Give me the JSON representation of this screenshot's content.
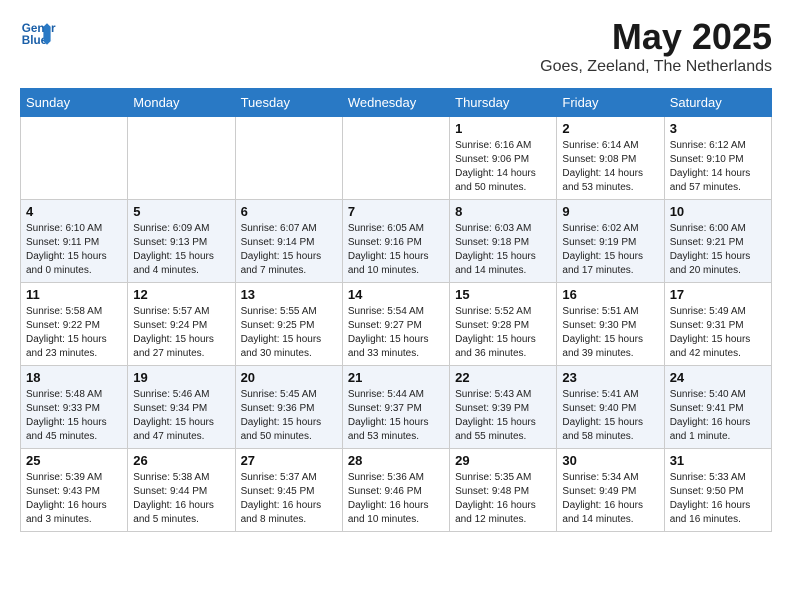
{
  "logo": {
    "line1": "General",
    "line2": "Blue"
  },
  "title": "May 2025",
  "location": "Goes, Zeeland, The Netherlands",
  "weekdays": [
    "Sunday",
    "Monday",
    "Tuesday",
    "Wednesday",
    "Thursday",
    "Friday",
    "Saturday"
  ],
  "weeks": [
    [
      {
        "day": "",
        "info": ""
      },
      {
        "day": "",
        "info": ""
      },
      {
        "day": "",
        "info": ""
      },
      {
        "day": "",
        "info": ""
      },
      {
        "day": "1",
        "info": "Sunrise: 6:16 AM\nSunset: 9:06 PM\nDaylight: 14 hours\nand 50 minutes."
      },
      {
        "day": "2",
        "info": "Sunrise: 6:14 AM\nSunset: 9:08 PM\nDaylight: 14 hours\nand 53 minutes."
      },
      {
        "day": "3",
        "info": "Sunrise: 6:12 AM\nSunset: 9:10 PM\nDaylight: 14 hours\nand 57 minutes."
      }
    ],
    [
      {
        "day": "4",
        "info": "Sunrise: 6:10 AM\nSunset: 9:11 PM\nDaylight: 15 hours\nand 0 minutes."
      },
      {
        "day": "5",
        "info": "Sunrise: 6:09 AM\nSunset: 9:13 PM\nDaylight: 15 hours\nand 4 minutes."
      },
      {
        "day": "6",
        "info": "Sunrise: 6:07 AM\nSunset: 9:14 PM\nDaylight: 15 hours\nand 7 minutes."
      },
      {
        "day": "7",
        "info": "Sunrise: 6:05 AM\nSunset: 9:16 PM\nDaylight: 15 hours\nand 10 minutes."
      },
      {
        "day": "8",
        "info": "Sunrise: 6:03 AM\nSunset: 9:18 PM\nDaylight: 15 hours\nand 14 minutes."
      },
      {
        "day": "9",
        "info": "Sunrise: 6:02 AM\nSunset: 9:19 PM\nDaylight: 15 hours\nand 17 minutes."
      },
      {
        "day": "10",
        "info": "Sunrise: 6:00 AM\nSunset: 9:21 PM\nDaylight: 15 hours\nand 20 minutes."
      }
    ],
    [
      {
        "day": "11",
        "info": "Sunrise: 5:58 AM\nSunset: 9:22 PM\nDaylight: 15 hours\nand 23 minutes."
      },
      {
        "day": "12",
        "info": "Sunrise: 5:57 AM\nSunset: 9:24 PM\nDaylight: 15 hours\nand 27 minutes."
      },
      {
        "day": "13",
        "info": "Sunrise: 5:55 AM\nSunset: 9:25 PM\nDaylight: 15 hours\nand 30 minutes."
      },
      {
        "day": "14",
        "info": "Sunrise: 5:54 AM\nSunset: 9:27 PM\nDaylight: 15 hours\nand 33 minutes."
      },
      {
        "day": "15",
        "info": "Sunrise: 5:52 AM\nSunset: 9:28 PM\nDaylight: 15 hours\nand 36 minutes."
      },
      {
        "day": "16",
        "info": "Sunrise: 5:51 AM\nSunset: 9:30 PM\nDaylight: 15 hours\nand 39 minutes."
      },
      {
        "day": "17",
        "info": "Sunrise: 5:49 AM\nSunset: 9:31 PM\nDaylight: 15 hours\nand 42 minutes."
      }
    ],
    [
      {
        "day": "18",
        "info": "Sunrise: 5:48 AM\nSunset: 9:33 PM\nDaylight: 15 hours\nand 45 minutes."
      },
      {
        "day": "19",
        "info": "Sunrise: 5:46 AM\nSunset: 9:34 PM\nDaylight: 15 hours\nand 47 minutes."
      },
      {
        "day": "20",
        "info": "Sunrise: 5:45 AM\nSunset: 9:36 PM\nDaylight: 15 hours\nand 50 minutes."
      },
      {
        "day": "21",
        "info": "Sunrise: 5:44 AM\nSunset: 9:37 PM\nDaylight: 15 hours\nand 53 minutes."
      },
      {
        "day": "22",
        "info": "Sunrise: 5:43 AM\nSunset: 9:39 PM\nDaylight: 15 hours\nand 55 minutes."
      },
      {
        "day": "23",
        "info": "Sunrise: 5:41 AM\nSunset: 9:40 PM\nDaylight: 15 hours\nand 58 minutes."
      },
      {
        "day": "24",
        "info": "Sunrise: 5:40 AM\nSunset: 9:41 PM\nDaylight: 16 hours\nand 1 minute."
      }
    ],
    [
      {
        "day": "25",
        "info": "Sunrise: 5:39 AM\nSunset: 9:43 PM\nDaylight: 16 hours\nand 3 minutes."
      },
      {
        "day": "26",
        "info": "Sunrise: 5:38 AM\nSunset: 9:44 PM\nDaylight: 16 hours\nand 5 minutes."
      },
      {
        "day": "27",
        "info": "Sunrise: 5:37 AM\nSunset: 9:45 PM\nDaylight: 16 hours\nand 8 minutes."
      },
      {
        "day": "28",
        "info": "Sunrise: 5:36 AM\nSunset: 9:46 PM\nDaylight: 16 hours\nand 10 minutes."
      },
      {
        "day": "29",
        "info": "Sunrise: 5:35 AM\nSunset: 9:48 PM\nDaylight: 16 hours\nand 12 minutes."
      },
      {
        "day": "30",
        "info": "Sunrise: 5:34 AM\nSunset: 9:49 PM\nDaylight: 16 hours\nand 14 minutes."
      },
      {
        "day": "31",
        "info": "Sunrise: 5:33 AM\nSunset: 9:50 PM\nDaylight: 16 hours\nand 16 minutes."
      }
    ]
  ]
}
